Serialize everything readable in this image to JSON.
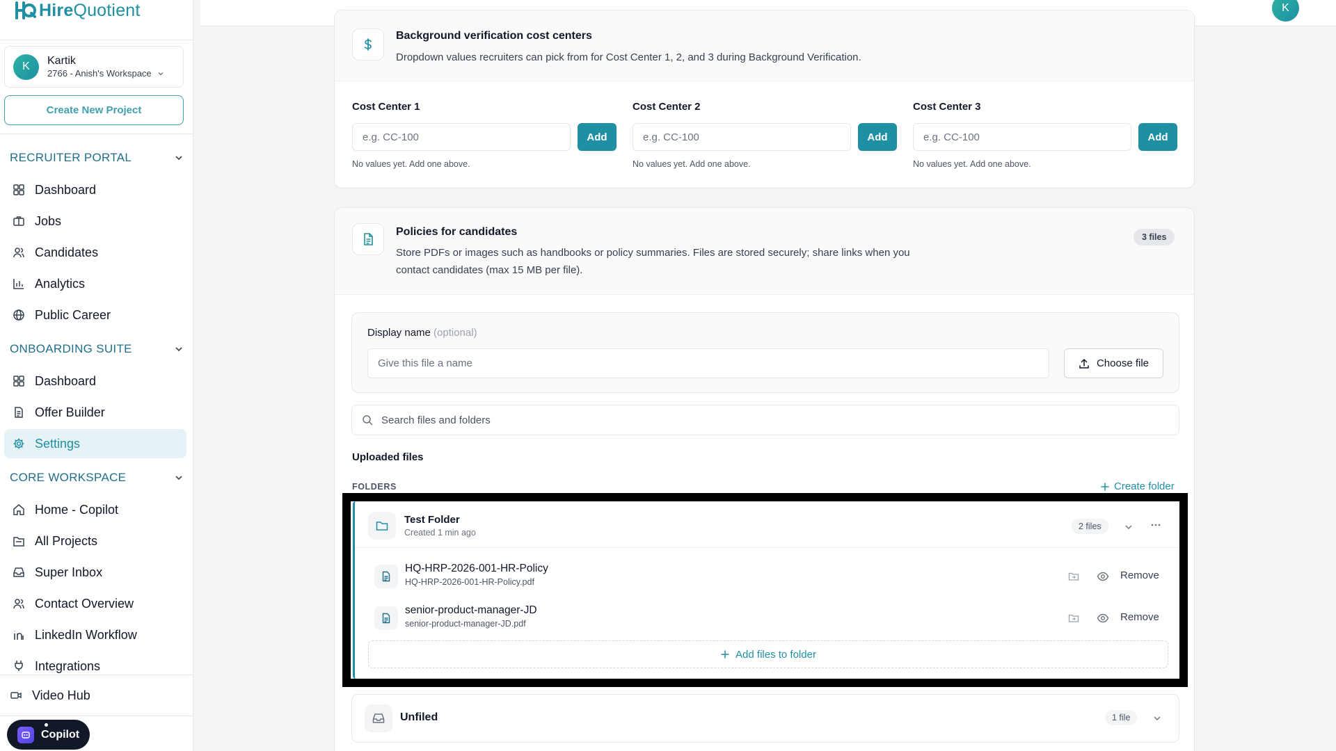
{
  "brand": {
    "name_bold": "Hire",
    "name_rest": "Quotient",
    "color": "#1f8fa3"
  },
  "user": {
    "initial": "K",
    "name": "Kartik",
    "workspace": "2766 - Anish's Workspace"
  },
  "sidebar": {
    "create_project": "Create New Project",
    "sections": [
      {
        "title": "RECRUITER PORTAL",
        "items": [
          {
            "label": "Dashboard",
            "icon": "dashboard-icon"
          },
          {
            "label": "Jobs",
            "icon": "briefcase-icon"
          },
          {
            "label": "Candidates",
            "icon": "users-icon"
          },
          {
            "label": "Analytics",
            "icon": "bar-chart-icon"
          },
          {
            "label": "Public Career",
            "icon": "globe-icon"
          }
        ]
      },
      {
        "title": "ONBOARDING SUITE",
        "items": [
          {
            "label": "Dashboard",
            "icon": "dashboard-icon"
          },
          {
            "label": "Offer Builder",
            "icon": "document-icon"
          },
          {
            "label": "Settings",
            "icon": "gear-icon",
            "active": true
          }
        ]
      },
      {
        "title": "CORE WORKSPACE",
        "items": [
          {
            "label": "Home - Copilot",
            "icon": "home-icon"
          },
          {
            "label": "All Projects",
            "icon": "folder-icon"
          },
          {
            "label": "Super Inbox",
            "icon": "inbox-icon"
          },
          {
            "label": "Contact Overview",
            "icon": "users-icon"
          },
          {
            "label": "LinkedIn Workflow",
            "icon": "linkedin-icon"
          },
          {
            "label": "Integrations",
            "icon": "plug-icon"
          }
        ]
      }
    ],
    "video_hub": "Video Hub",
    "copilot": "Copilot"
  },
  "topbar": {
    "avatar_initial": "K"
  },
  "cost_centers": {
    "title": "Background verification cost centers",
    "description": "Dropdown values recruiters can pick from for Cost Center 1, 2, and 3 during Background Verification.",
    "columns": [
      {
        "label": "Cost Center 1",
        "placeholder": "e.g. CC-100",
        "add": "Add",
        "empty": "No values yet. Add one above."
      },
      {
        "label": "Cost Center 2",
        "placeholder": "e.g. CC-100",
        "add": "Add",
        "empty": "No values yet. Add one above."
      },
      {
        "label": "Cost Center 3",
        "placeholder": "e.g. CC-100",
        "add": "Add",
        "empty": "No values yet. Add one above."
      }
    ]
  },
  "policies": {
    "title": "Policies for candidates",
    "description_line1": "Store PDFs or images such as handbooks or policy summaries. Files are stored securely; share links when you",
    "description_line2": "contact candidates (max 15 MB per file).",
    "files_badge": "3 files",
    "display_name_label": "Display name",
    "display_name_optional": "(optional)",
    "display_name_placeholder": "Give this file a name",
    "choose_file": "Choose file",
    "search_placeholder": "Search files and folders",
    "uploaded_heading": "Uploaded files",
    "folders_heading": "FOLDERS",
    "create_folder": "Create folder",
    "folder": {
      "name": "Test Folder",
      "created": "Created 1 min ago",
      "badge": "2 files",
      "files": [
        {
          "name": "HQ-HRP-2026-001-HR-Policy",
          "filename": "HQ-HRP-2026-001-HR-Policy.pdf",
          "remove": "Remove"
        },
        {
          "name": "senior-product-manager-JD",
          "filename": "senior-product-manager-JD.pdf",
          "remove": "Remove"
        }
      ],
      "add_files": "Add files to folder"
    },
    "unfiled": {
      "name": "Unfiled",
      "badge": "1 file"
    }
  }
}
